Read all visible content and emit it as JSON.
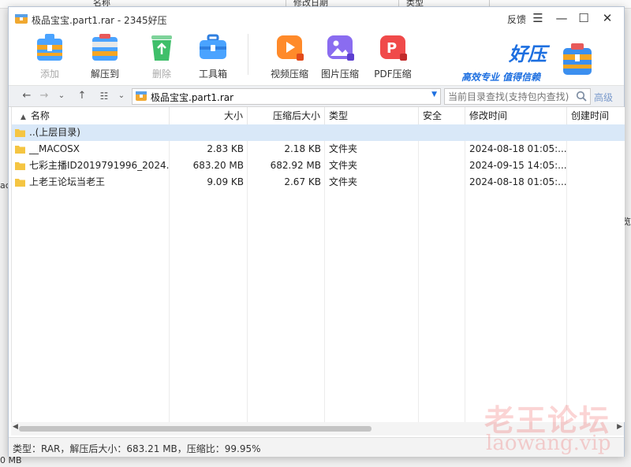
{
  "background": {
    "col_name": "名称",
    "col_modified": "修改日期",
    "col_type": "类型",
    "left_frag": "ad",
    "right_frag": "览",
    "bottom_frag": "0 MB"
  },
  "window": {
    "title": "极品宝宝.part1.rar - 2345好压",
    "feedback": "反馈"
  },
  "toolbar": {
    "add": "添加",
    "extract": "解压到",
    "delete": "删除",
    "toolbox": "工具箱",
    "video": "视频压缩",
    "image": "图片压缩",
    "pdf": "PDF压缩"
  },
  "brand": {
    "name": "好压",
    "slogan": "高效专业  值得信赖"
  },
  "address": {
    "path": "极品宝宝.part1.rar",
    "search_placeholder": "当前目录查找(支持包内查找)",
    "advanced": "高级"
  },
  "columns": {
    "name": "名称",
    "size": "大小",
    "packed": "压缩后大小",
    "type": "类型",
    "security": "安全",
    "modified": "修改时间",
    "created": "创建时间"
  },
  "files": [
    {
      "name": "..(上层目录)",
      "size": "",
      "packed": "",
      "type": "",
      "security": "",
      "modified": "",
      "created": ""
    },
    {
      "name": "__MACOSX",
      "size": "2.83 KB",
      "packed": "2.18 KB",
      "type": "文件夹",
      "security": "",
      "modified": "2024-08-18 01:05:...",
      "created": ""
    },
    {
      "name": "七彩主播ID2019791996_2024...",
      "size": "683.20 MB",
      "packed": "682.92 MB",
      "type": "文件夹",
      "security": "",
      "modified": "2024-09-15 14:05:...",
      "created": ""
    },
    {
      "name": "上老王论坛当老王",
      "size": "9.09 KB",
      "packed": "2.67 KB",
      "type": "文件夹",
      "security": "",
      "modified": "2024-08-18 01:05:...",
      "created": ""
    }
  ],
  "status": "类型：RAR，解压后大小：683.21 MB，压缩比：99.95%",
  "watermark": {
    "cn": "老王论坛",
    "en": "laowang.vip"
  },
  "colors": {
    "accent": "#1d6fe0",
    "selected_row": "#d9e8f8",
    "folder": "#f5c542"
  }
}
